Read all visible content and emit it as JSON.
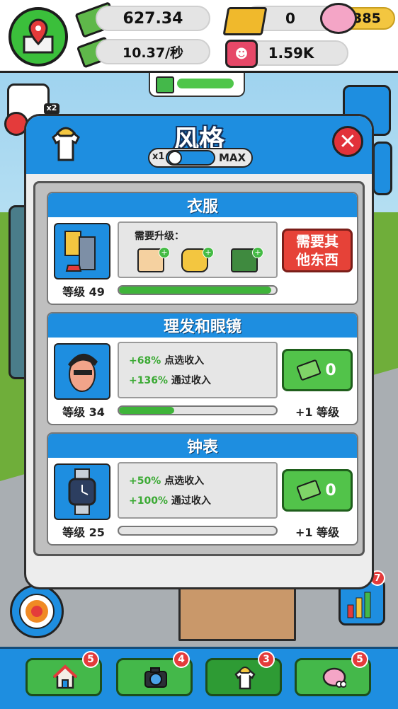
{
  "top": {
    "cash": "627.34",
    "rate": "10.37/秒",
    "gold": "0",
    "fame": "1.59K",
    "piggy": "385"
  },
  "side": {
    "multiplier_badge": "x2"
  },
  "modal": {
    "title": "风格",
    "toggle_left": "x1",
    "toggle_right": "MAX",
    "close_label": "✕"
  },
  "cards": [
    {
      "title": "衣服",
      "level": "等级 49",
      "progress": 0.97,
      "requirement_title": "需要升级：",
      "requirement_icons": [
        "store-icon",
        "car-icon",
        "field-icon"
      ],
      "action": "需要其他东西"
    },
    {
      "title": "理发和眼镜",
      "level": "等级 34",
      "progress": 0.35,
      "bonus_1_pct": "+68%",
      "bonus_1_text": "点选收入",
      "bonus_2_pct": "+136%",
      "bonus_2_text": "通过收入",
      "buy_value": "0",
      "plus_level": "+1 等级"
    },
    {
      "title": "钟表",
      "level": "等级 25",
      "progress": 0.0,
      "bonus_1_pct": "+50%",
      "bonus_1_text": "点选收入",
      "bonus_2_pct": "+100%",
      "bonus_2_text": "通过收入",
      "buy_value": "0",
      "plus_level": "+1 等级"
    }
  ],
  "nav": [
    {
      "icon": "house-icon",
      "badge": "5"
    },
    {
      "icon": "camera-icon",
      "badge": "4"
    },
    {
      "icon": "shirt-icon",
      "badge": "3"
    },
    {
      "icon": "brain-icon",
      "badge": "5"
    }
  ],
  "stats_badge": "7",
  "colors": {
    "accent": "#1e8ee0",
    "green": "#52c34a",
    "red": "#e64238"
  }
}
